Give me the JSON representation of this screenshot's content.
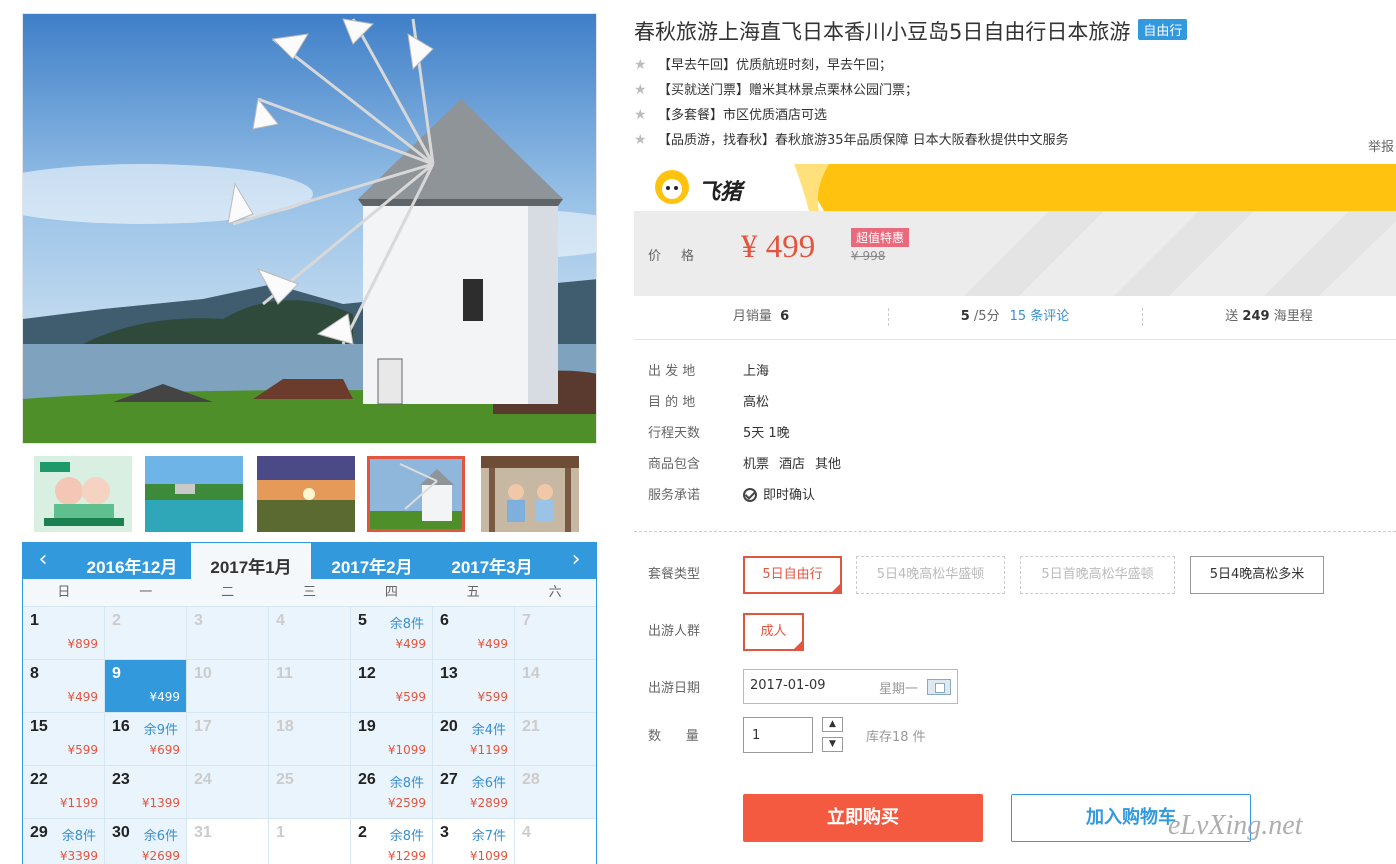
{
  "product": {
    "title": "春秋旅游上海直飞日本香川小豆岛5日自由行日本旅游",
    "tag": "自由行",
    "features": [
      "【早去午回】优质航班时刻，早去午回；",
      "【买就送门票】赠米其林景点栗林公园门票；",
      "【多套餐】市区优质酒店可选",
      "【品质游，找春秋】春秋旅游35年品质保障 日本大阪春秋提供中文服务"
    ],
    "report_label": "举报"
  },
  "brand": {
    "name": "飞猪",
    "accent": "#ffc20e"
  },
  "price": {
    "label": "价格",
    "value": "¥ 499",
    "badge": "超值特惠",
    "original": "¥ 998"
  },
  "stats": {
    "monthly_sales_label": "月销量",
    "monthly_sales": "6",
    "rating": "5",
    "rating_suffix": "/5分",
    "reviews_link": "15 条评论",
    "miles_prefix": "送",
    "miles": "249",
    "miles_suffix": "海里程"
  },
  "info": {
    "depart_label": "出 发 地",
    "depart": "上海",
    "dest_label": "目 的 地",
    "dest": "高松",
    "days_label": "行程天数",
    "days": "5天 1晚",
    "includes_label": "商品包含",
    "includes": [
      "机票",
      "酒店",
      "其他"
    ],
    "service_label": "服务承诺",
    "service": "即时确认"
  },
  "options": {
    "package_label": "套餐类型",
    "packages": [
      "5日自由行",
      "5日4晚高松华盛顿",
      "5日首晚高松华盛顿",
      "5日4晚高松多米"
    ],
    "crowd_label": "出游人群",
    "crowd": "成人",
    "date_label": "出游日期",
    "date": "2017-01-09",
    "weekday": "星期一",
    "qty_label": "数      量",
    "qty": "1",
    "stock": "库存18 件"
  },
  "actions": {
    "buy": "立即购买",
    "cart": "加入购物车"
  },
  "watermark": "eLvXing.net",
  "calendar": {
    "prev": "‹",
    "next": "›",
    "tabs": [
      "2016年12月",
      "2017年1月",
      "2017年2月",
      "2017年3月"
    ],
    "active_tab": 1,
    "weekdays": [
      "日",
      "一",
      "二",
      "三",
      "四",
      "五",
      "六"
    ],
    "rows": [
      [
        {
          "d": "1",
          "p": "¥899"
        },
        {
          "d": "2",
          "dim": true
        },
        {
          "d": "3",
          "dim": true
        },
        {
          "d": "4",
          "dim": true
        },
        {
          "d": "5",
          "s": "余8件",
          "p": "¥499"
        },
        {
          "d": "6",
          "p": "¥499"
        },
        {
          "d": "7",
          "dim": true
        }
      ],
      [
        {
          "d": "8",
          "p": "¥499"
        },
        {
          "d": "9",
          "p": "¥499",
          "sel": true
        },
        {
          "d": "10",
          "dim": true
        },
        {
          "d": "11",
          "dim": true
        },
        {
          "d": "12",
          "p": "¥599"
        },
        {
          "d": "13",
          "p": "¥599"
        },
        {
          "d": "14",
          "dim": true
        }
      ],
      [
        {
          "d": "15",
          "p": "¥599"
        },
        {
          "d": "16",
          "s": "余9件",
          "p": "¥699"
        },
        {
          "d": "17",
          "dim": true
        },
        {
          "d": "18",
          "dim": true
        },
        {
          "d": "19",
          "p": "¥1099"
        },
        {
          "d": "20",
          "s": "余4件",
          "p": "¥1199"
        },
        {
          "d": "21",
          "dim": true
        }
      ],
      [
        {
          "d": "22",
          "p": "¥1199"
        },
        {
          "d": "23",
          "p": "¥1399"
        },
        {
          "d": "24",
          "dim": true
        },
        {
          "d": "25",
          "dim": true
        },
        {
          "d": "26",
          "s": "余8件",
          "p": "¥2599"
        },
        {
          "d": "27",
          "s": "余6件",
          "p": "¥2899"
        },
        {
          "d": "28",
          "dim": true
        }
      ],
      [
        {
          "d": "29",
          "s": "余8件",
          "p": "¥3399"
        },
        {
          "d": "30",
          "s": "余6件",
          "p": "¥2699"
        },
        {
          "d": "31",
          "dim": true,
          "white": true
        },
        {
          "d": "1",
          "dim": true,
          "white": true
        },
        {
          "d": "2",
          "s": "余8件",
          "p": "¥1299",
          "white": true
        },
        {
          "d": "3",
          "s": "余7件",
          "p": "¥1099",
          "white": true
        },
        {
          "d": "4",
          "dim": true,
          "white": true
        }
      ]
    ]
  }
}
